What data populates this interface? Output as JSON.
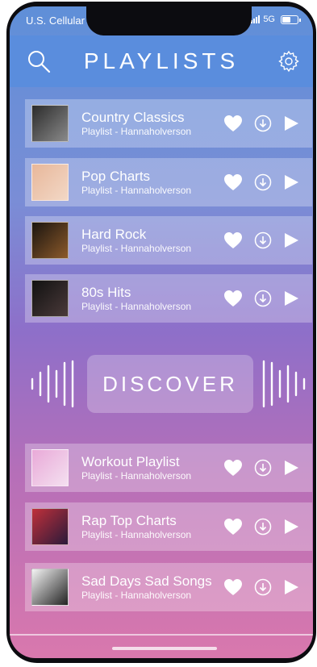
{
  "status": {
    "carrier": "U.S. Cellular",
    "network": "5G"
  },
  "header": {
    "title": "PLAYLISTS"
  },
  "discover": {
    "label": "DISCOVER"
  },
  "playlists": [
    {
      "title": "Country Classics",
      "subtitle": "Playlist - Hannaholverson",
      "thumb_colors": [
        "#2b2b2b",
        "#8a8a8a"
      ]
    },
    {
      "title": "Pop Charts",
      "subtitle": "Playlist - Hannaholverson",
      "thumb_colors": [
        "#e8b79a",
        "#f2d8c6"
      ]
    },
    {
      "title": "Hard Rock",
      "subtitle": "Playlist - Hannaholverson",
      "thumb_colors": [
        "#1a1410",
        "#8c5a2a"
      ]
    },
    {
      "title": "80s Hits",
      "subtitle": "Playlist - Hannaholverson",
      "thumb_colors": [
        "#111111",
        "#4a3a3a"
      ]
    },
    {
      "title": "Workout Playlist",
      "subtitle": "Playlist - Hannaholverson",
      "thumb_colors": [
        "#e9a9d8",
        "#f4e0f0"
      ]
    },
    {
      "title": "Rap Top Charts",
      "subtitle": "Playlist - Hannaholverson",
      "thumb_colors": [
        "#c0303a",
        "#2a1a3a"
      ]
    },
    {
      "title": "Sad Days Sad Songs",
      "subtitle": "Playlist - Hannaholverson",
      "thumb_colors": [
        "#f4f4f4",
        "#222222"
      ]
    }
  ],
  "colors": {
    "header": "#5a8ddd",
    "accent": "#ffffff"
  },
  "icons": {
    "search": "search-icon",
    "settings": "gear-icon",
    "like": "heart-icon",
    "download": "download-icon",
    "play": "play-icon"
  }
}
